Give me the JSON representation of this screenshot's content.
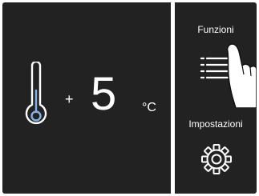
{
  "temperature": {
    "sign": "+",
    "value": "5",
    "unit": "°C",
    "icon": "thermometer-icon"
  },
  "side_menu": {
    "functions_label": "Funzioni",
    "functions_icon": "list-menu-icon",
    "settings_label": "Impostazioni",
    "settings_icon": "gear-icon"
  },
  "colors": {
    "background": "#222222",
    "foreground": "#ffffff",
    "accent": "#7fb0e8"
  }
}
